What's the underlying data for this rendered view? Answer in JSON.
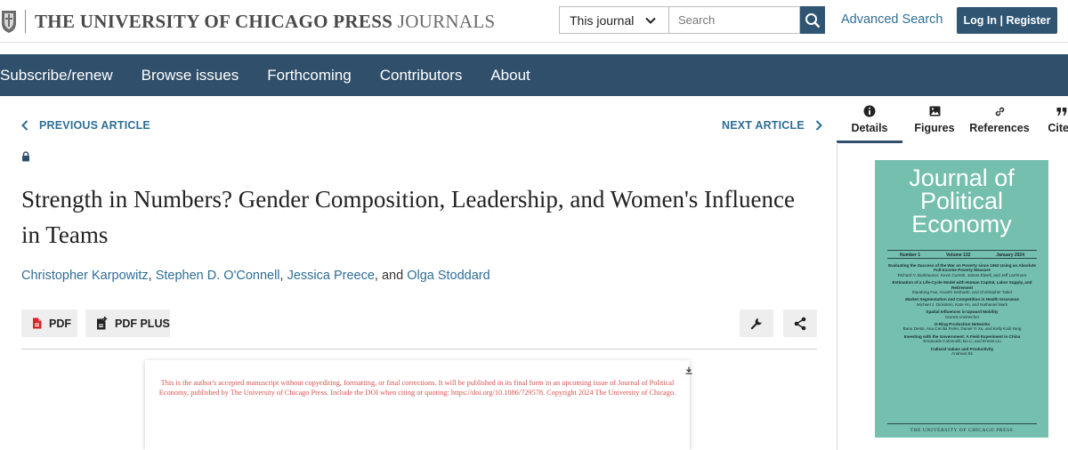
{
  "header": {
    "logo_main": "THE UNIVERSITY OF CHICAGO PRESS",
    "logo_sub": "JOURNALS",
    "scope_select": "This journal",
    "search_placeholder": "Search",
    "advanced_search": "Advanced Search",
    "login_label": "Log In | Register"
  },
  "nav": {
    "items": [
      "Subscribe/renew",
      "Browse issues",
      "Forthcoming",
      "Contributors",
      "About"
    ]
  },
  "article": {
    "prev_label": "PREVIOUS ARTICLE",
    "next_label": "NEXT ARTICLE",
    "title": "Strength in Numbers? Gender Composition, Leadership, and Women's Influence in Teams",
    "authors": [
      "Christopher Karpowitz",
      "Stephen D. O'Connell",
      "Jessica Preece",
      "Olga Stoddard"
    ],
    "author_sep1": ", ",
    "author_sep2": ", ",
    "author_sep3": ", and ",
    "pdf_label": "PDF",
    "pdfplus_label": "PDF PLUS",
    "manuscript_notice": "This is the author's accepted manuscript without copyediting, formatting, or final corrections. It will be published in its final form in an upcoming issue of Journal of Political Economy, published by The University of Chicago Press. Include the DOI when citing or quoting: https://doi.org/10.1086/729578. Copyright 2024 The University of Chicago."
  },
  "side_panel": {
    "tabs": [
      "Details",
      "Figures",
      "References",
      "Cited"
    ],
    "active_tab": "Details"
  },
  "cover": {
    "title": "Journal of Political Economy",
    "number": "Number 1",
    "volume": "Volume 132",
    "date": "January 2024",
    "contents": [
      {
        "title": "Evaluating the Success of the War on Poverty since 1963 Using an Absolute Full-Income Poverty Measure",
        "authors": "Richard V. Burkhauser, Kevin Corinth, James Elwell, and Jeff Larrimore"
      },
      {
        "title": "Estimation of a Life-Cycle Model with Human Capital, Labor Supply, and Retirement",
        "authors": "Xiaodong Fan, Ananth Seshadri, and Christopher Taber"
      },
      {
        "title": "Market Segmentation and Competition in Health Insurance",
        "authors": "Michael J. Dickstein, Kate Ho, and Nathaniel Mark"
      },
      {
        "title": "Spatial Influences in Upward Mobility",
        "authors": "Garrett Anstreicher"
      },
      {
        "title": "O-Ring Production Networks",
        "authors": "Banu Demir, Ana Cecília Fieler, Daniel Yi Xu, and Kelly Kaili Yang"
      },
      {
        "title": "Investing with the Government: A Field Experiment in China",
        "authors": "Emanuele Colonnelli, Bo Li, and Ernest Liu"
      },
      {
        "title": "Cultural Values and Productivity",
        "authors": "Andreas Ek"
      }
    ],
    "publisher": "THE UNIVERSITY OF CHICAGO PRESS"
  },
  "colors": {
    "nav_bg": "#2f4f6b",
    "accent_button": "#2f5573",
    "link": "#2f6e96",
    "cover_bg": "#74bfae",
    "notice_red": "#d9534f"
  },
  "icons": [
    "university-seal-icon",
    "chevron-down-icon",
    "search-icon",
    "chevron-left-icon",
    "chevron-right-icon",
    "lock-icon",
    "pdf-icon",
    "pdf-plus-icon",
    "wrench-icon",
    "share-icon",
    "download-icon",
    "info-icon",
    "image-icon",
    "link-icon",
    "quote-icon"
  ]
}
